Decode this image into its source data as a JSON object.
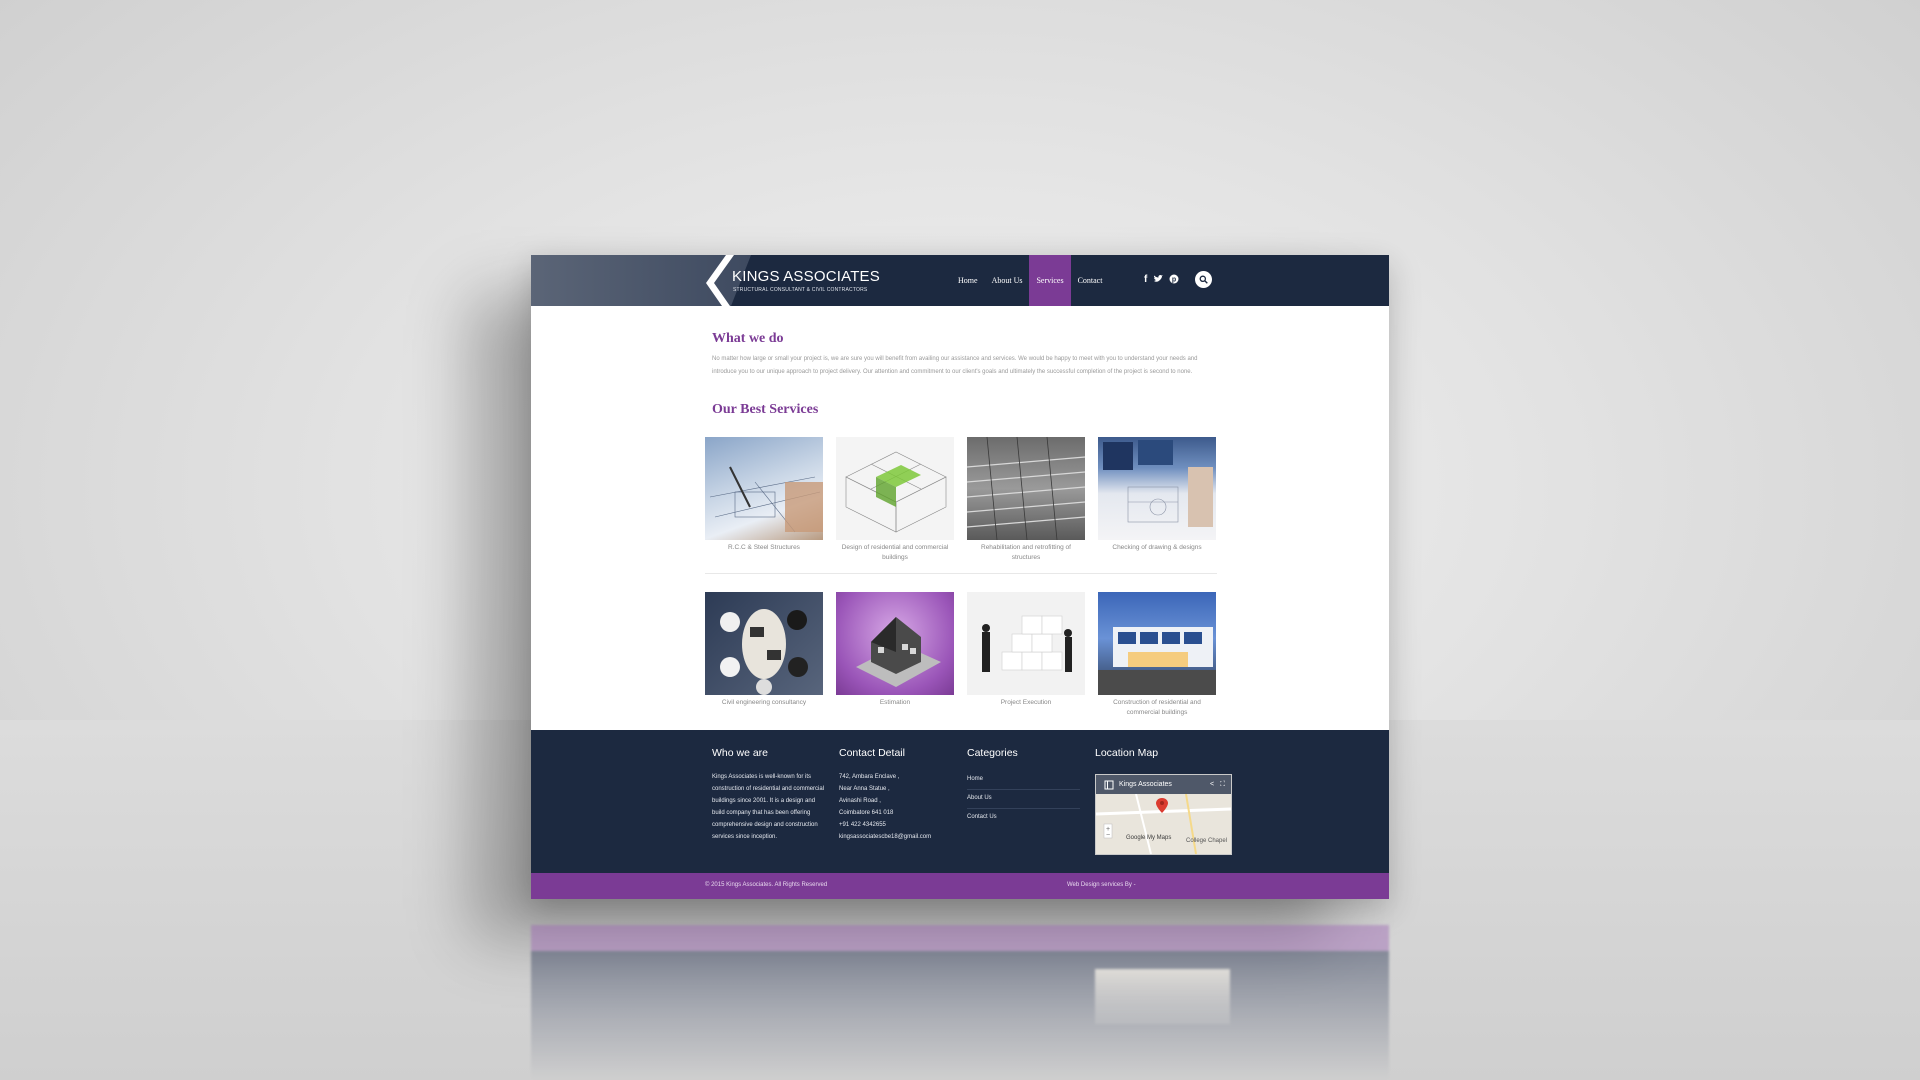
{
  "header": {
    "logo_title": "KINGS ASSOCIATES",
    "logo_tagline": "STRUCTURAL CONSULTANT & CIVIL CONTRACTORS",
    "nav": [
      "Home",
      "About Us",
      "Services",
      "Contact"
    ],
    "active_nav": "Services",
    "social_icons": [
      "facebook-icon",
      "twitter-icon",
      "pinterest-icon"
    ]
  },
  "what_we_do": {
    "title": "What we do",
    "text": "No matter how large or small your project is, we are sure you will benefit from availing our assistance and services. We would be happy to meet with you to understand your needs and introduce you to our unique approach to project delivery. Our attention and commitment to our client's goals and ultimately the successful completion of the project is second to none."
  },
  "services": {
    "title": "Our Best Services",
    "row1": [
      {
        "caption": "R.C.C & Steel Structures"
      },
      {
        "caption": "Design of residential and commercial buildings"
      },
      {
        "caption": "Rehabilitation and retrofitting of structures"
      },
      {
        "caption": "Checking of drawing & designs"
      }
    ],
    "row2": [
      {
        "caption": "Civil engineering consultancy"
      },
      {
        "caption": "Estimation"
      },
      {
        "caption": "Project Execution"
      },
      {
        "caption": "Construction of residential and commercial buildings"
      }
    ]
  },
  "footer": {
    "who": {
      "title": "Who we are",
      "text": "Kings Associates is well-known for its construction of residential and commercial buildings since 2001. It is a design and build company that has been offering comprehensive design and construction services since inception."
    },
    "contact": {
      "title": "Contact Detail",
      "lines": [
        "742, Ambara Enclave ,",
        "Near Anna Statue ,",
        "Avinashi Road ,",
        "Coimbatore 641 018",
        "+91 422 4342655",
        "kingsassociatescbe18@gmail.com"
      ]
    },
    "categories": {
      "title": "Categories",
      "links": [
        "Home",
        "About Us",
        "Contact Us"
      ]
    },
    "map": {
      "title": "Location Map",
      "place_name": "Kings Associates",
      "label_google": "Google My Maps",
      "label_college": "College Chapel"
    }
  },
  "bottom_bar": {
    "copyright": "© 2015 Kings Associates. All Rights Reserved",
    "credit": "Web Design services By -"
  },
  "colors": {
    "navy": "#1c2940",
    "purple": "#7b3b95"
  }
}
